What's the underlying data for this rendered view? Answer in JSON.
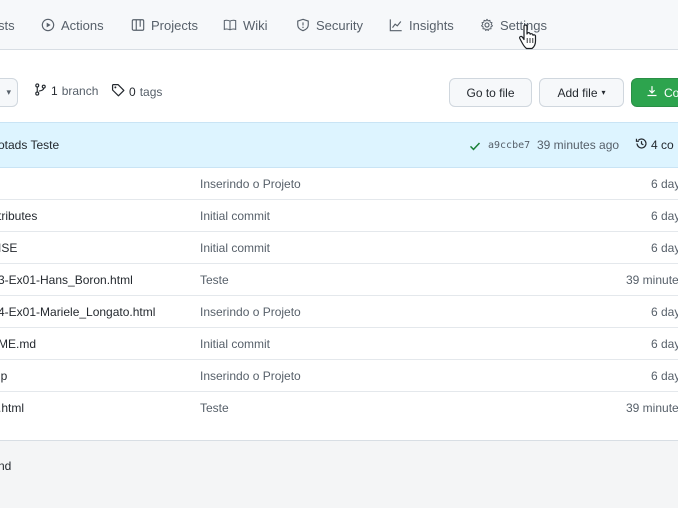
{
  "nav": {
    "tabs": [
      {
        "label": "sts",
        "icon": "none"
      },
      {
        "label": "Actions",
        "icon": "play-icon"
      },
      {
        "label": "Projects",
        "icon": "table-icon"
      },
      {
        "label": "Wiki",
        "icon": "book-icon"
      },
      {
        "label": "Security",
        "icon": "shield-icon"
      },
      {
        "label": "Insights",
        "icon": "graph-icon"
      },
      {
        "label": "Settings",
        "icon": "gear-icon"
      }
    ]
  },
  "repo_bar": {
    "branch_count": "1",
    "branch_label": "branch",
    "tag_count": "0",
    "tag_label": "tags",
    "go_to_file": "Go to file",
    "add_file": "Add file",
    "code_button": "Co"
  },
  "commit": {
    "message": "otads Teste",
    "hash": "a9ccbe7",
    "time": "39 minutes ago",
    "count": "4 co"
  },
  "files": [
    {
      "name": "",
      "message": "Inserindo o Projeto",
      "age": "6 day"
    },
    {
      "name": "tributes",
      "message": "Initial commit",
      "age": "6 day"
    },
    {
      "name": "ISE",
      "message": "Initial commit",
      "age": "6 day"
    },
    {
      "name": "3-Ex01-Hans_Boron.html",
      "message": "Teste",
      "age": "39 minute"
    },
    {
      "name": "4-Ex01-Mariele_Longato.html",
      "message": "Inserindo o Projeto",
      "age": "6 day"
    },
    {
      "name": "ME.md",
      "message": "Initial commit",
      "age": "6 day"
    },
    {
      "name": "ip",
      "message": "Inserindo o Projeto",
      "age": "6 day"
    },
    {
      "name": ".html",
      "message": "Teste",
      "age": "39 minute"
    }
  ],
  "readme": {
    "title": "nd"
  },
  "colors": {
    "accent_green": "#2da44e",
    "commit_bar": "#ddf4ff",
    "check_green": "#1a7f37"
  }
}
